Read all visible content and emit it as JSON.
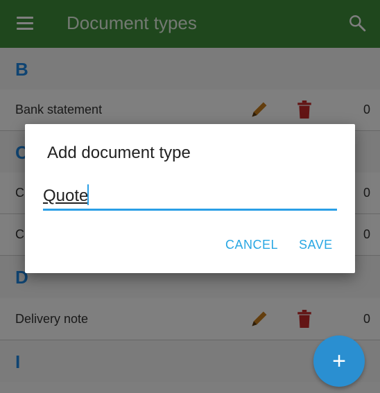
{
  "appbar": {
    "title": "Document types",
    "menu_icon": "menu-icon",
    "search_icon": "search-icon"
  },
  "sections": [
    {
      "letter": "B",
      "rows": [
        {
          "name": "Bank statement",
          "count": "0"
        }
      ]
    },
    {
      "letter": "C",
      "rows": [
        {
          "name": "C",
          "count": "0"
        },
        {
          "name": "C",
          "count": "0"
        }
      ]
    },
    {
      "letter": "D",
      "rows": [
        {
          "name": "Delivery note",
          "count": "0"
        }
      ]
    },
    {
      "letter": "I",
      "rows": []
    }
  ],
  "dialog": {
    "title": "Add document type",
    "input_value": "Quote",
    "cancel_label": "CANCEL",
    "save_label": "SAVE"
  },
  "fab": {
    "label": "+"
  },
  "colors": {
    "appbar": "#3f8f3a",
    "accent": "#29a7e3",
    "section_letter": "#1e88e5",
    "delete": "#c62828",
    "edit": "#c77c1d"
  }
}
